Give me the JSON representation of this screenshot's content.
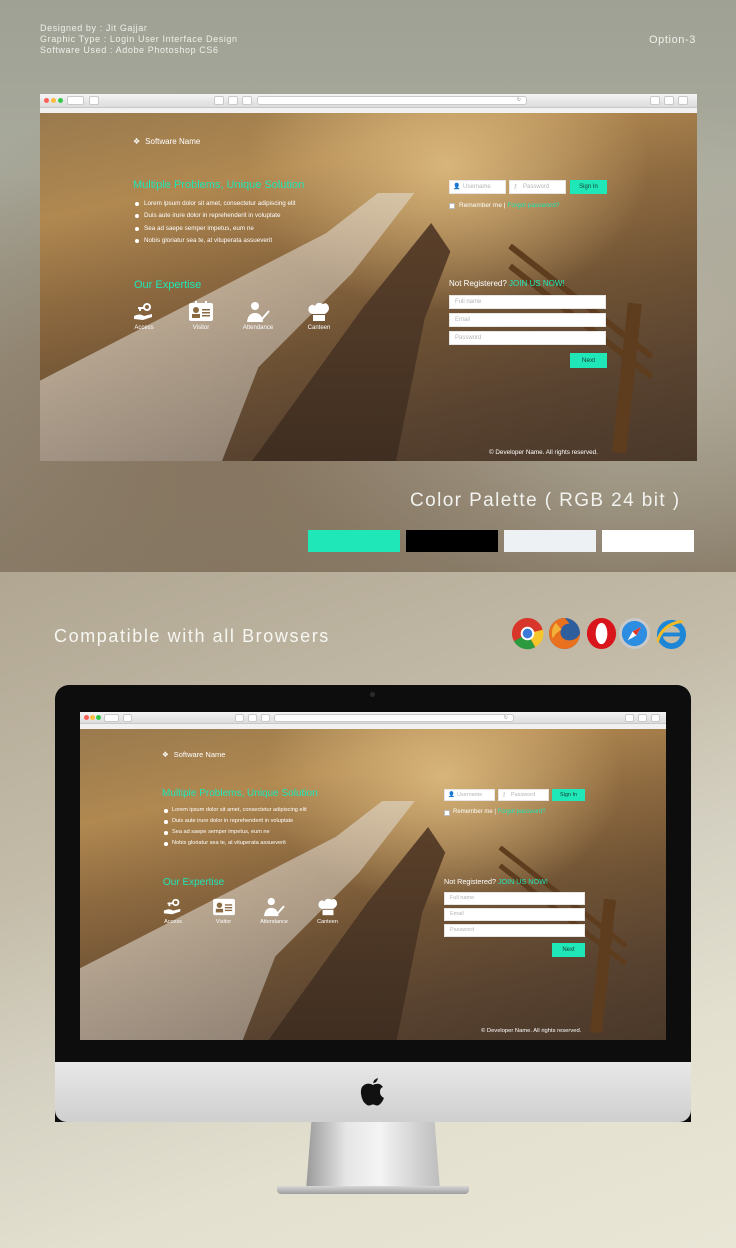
{
  "header": {
    "designed_by": "Designed by : Jit Gajjar",
    "graphic_type": "Graphic Type : Login User Interface Design",
    "software_used": "Software Used : Adobe Photoshop CS6",
    "option": "Option-3"
  },
  "app": {
    "brand": "Software Name",
    "headline": "Multiple Problems, Unique Solution",
    "bullets": [
      "Lorem ipsum dolor sit amet, consectetur adipiscing elit",
      "Duis aute irure dolor in reprehenderit in voluptate",
      "Sea ad saepe semper impetus, eum ne",
      "Nobis gloriatur sea te, at vituperata assueverit"
    ],
    "expertise_title": "Our Expertise",
    "features": [
      {
        "label": "Access",
        "icon": "hand-key-icon"
      },
      {
        "label": "Visitor",
        "icon": "id-card-icon"
      },
      {
        "label": "Attendance",
        "icon": "user-check-icon"
      },
      {
        "label": "Canteen",
        "icon": "chef-hat-icon"
      }
    ],
    "login": {
      "username_placeholder": "Username",
      "password_placeholder": "Password",
      "signin_label": "Sign In",
      "remember_label": "Remember me",
      "separator": "|",
      "forgot_label": "Forgot password?"
    },
    "register": {
      "prompt": "Not Registered?",
      "join_label": "JOIN US NOW!",
      "fullname_placeholder": "Full name",
      "email_placeholder": "Email",
      "password_placeholder": "Password",
      "next_label": "Next"
    },
    "footer": "© Developer Name. All rights reserved."
  },
  "palette": {
    "title": "Color Palette ( RGB 24 bit )",
    "colors": [
      "#1fe7b7",
      "#000000",
      "#eef1f3",
      "#ffffff"
    ]
  },
  "compatibility": {
    "title": "Compatible with all Browsers",
    "browsers": [
      "chrome-icon",
      "firefox-icon",
      "opera-icon",
      "safari-icon",
      "internet-explorer-icon"
    ]
  }
}
